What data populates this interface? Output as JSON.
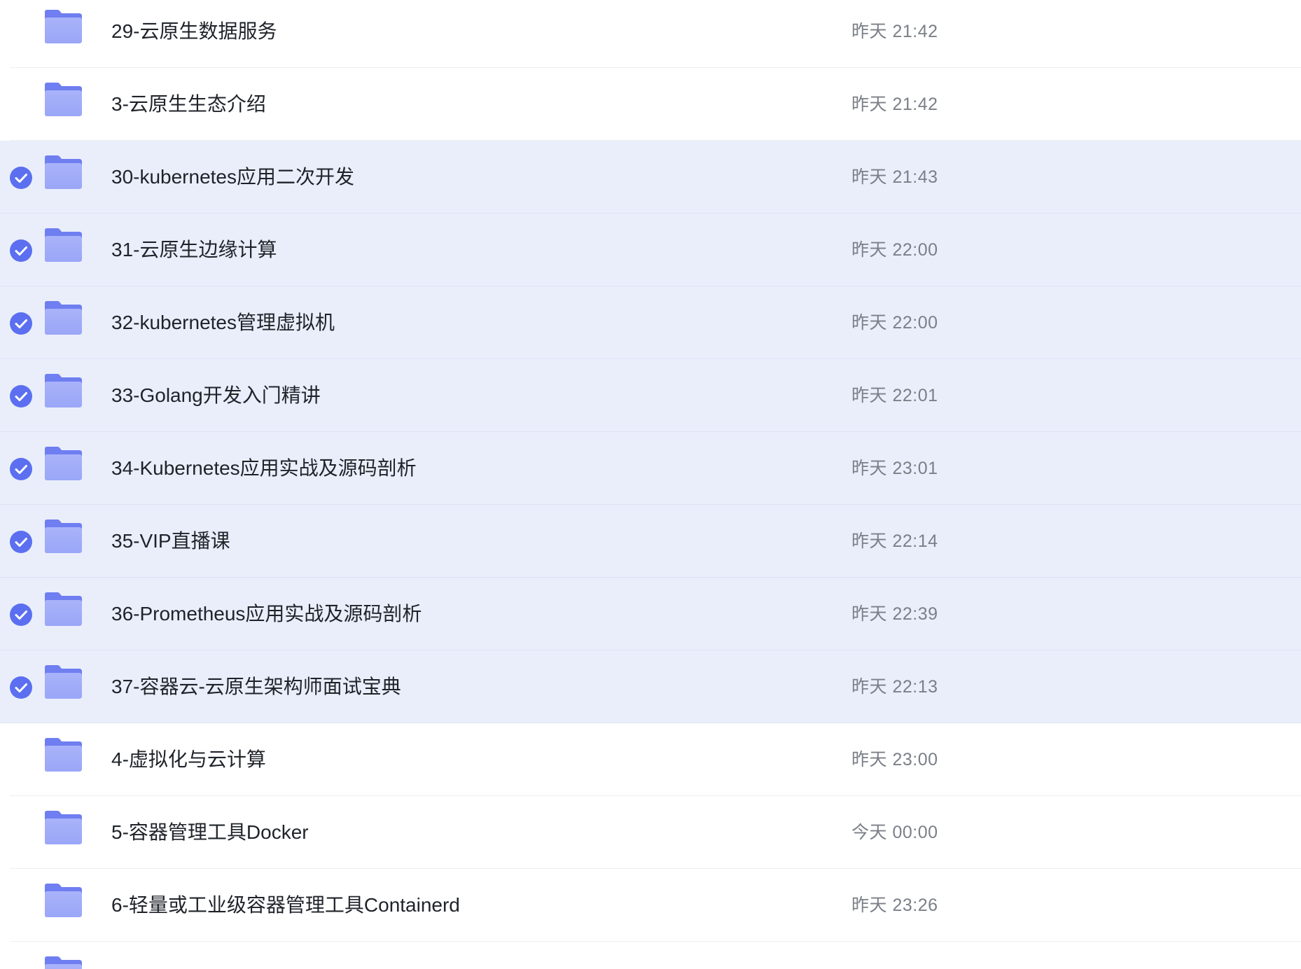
{
  "colors": {
    "selected_row_bg": "#eaeefb",
    "checkbox_blue": "#5b6ff0",
    "folder_front": "#9aa6f7",
    "folder_back": "#6f7ef0",
    "name_text": "#1f2329",
    "time_text": "#7b7f87"
  },
  "icons": {
    "folder": "folder-icon",
    "check": "check-circle-icon"
  },
  "files": [
    {
      "name": "29-云原生数据服务",
      "time": "昨天 21:42",
      "selected": false
    },
    {
      "name": "3-云原生生态介绍",
      "time": "昨天 21:42",
      "selected": false
    },
    {
      "name": "30-kubernetes应用二次开发",
      "time": "昨天 21:43",
      "selected": true
    },
    {
      "name": "31-云原生边缘计算",
      "time": "昨天 22:00",
      "selected": true
    },
    {
      "name": "32-kubernetes管理虚拟机",
      "time": "昨天 22:00",
      "selected": true
    },
    {
      "name": "33-Golang开发入门精讲",
      "time": "昨天 22:01",
      "selected": true
    },
    {
      "name": "34-Kubernetes应用实战及源码剖析",
      "time": "昨天 23:01",
      "selected": true
    },
    {
      "name": "35-VIP直播课",
      "time": "昨天 22:14",
      "selected": true
    },
    {
      "name": "36-Prometheus应用实战及源码剖析",
      "time": "昨天 22:39",
      "selected": true
    },
    {
      "name": "37-容器云-云原生架构师面试宝典",
      "time": "昨天 22:13",
      "selected": true
    },
    {
      "name": "4-虚拟化与云计算",
      "time": "昨天 23:00",
      "selected": false
    },
    {
      "name": "5-容器管理工具Docker",
      "time": "今天 00:00",
      "selected": false
    },
    {
      "name": "6-轻量或工业级容器管理工具Containerd",
      "time": "昨天 23:26",
      "selected": false
    },
    {
      "name": "",
      "time": "",
      "selected": false
    }
  ]
}
